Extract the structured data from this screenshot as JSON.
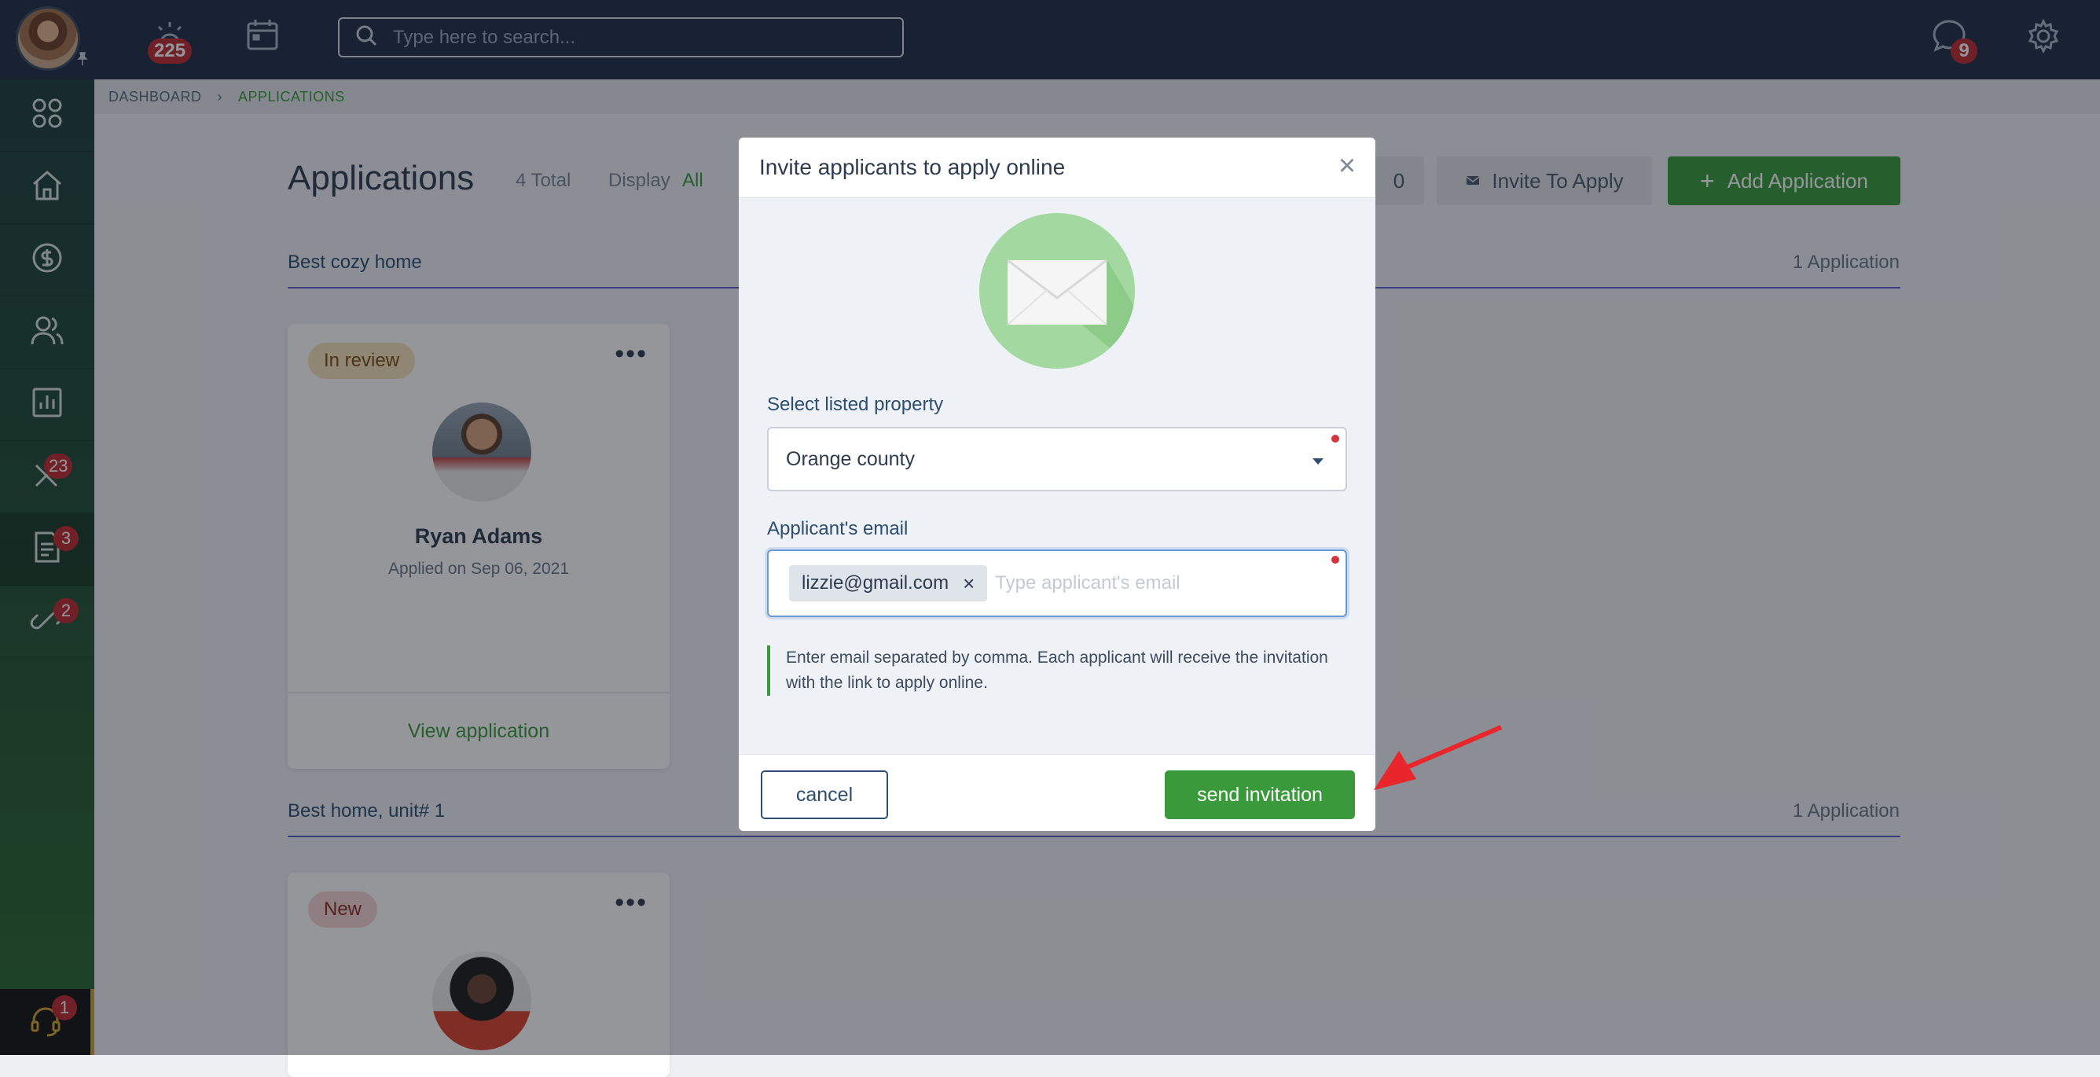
{
  "topbar": {
    "alerts_badge": "225",
    "search_placeholder": "Type here to search...",
    "messages_badge": "9"
  },
  "sidebar": {
    "badges": {
      "maintenance": "23",
      "applications": "3",
      "links": "2",
      "support": "1"
    }
  },
  "breadcrumb": {
    "home": "DASHBOARD",
    "current": "APPLICATIONS"
  },
  "page": {
    "title": "Applications",
    "total": "4 Total",
    "display_label": "Display",
    "display_value": "All",
    "count": "0",
    "invite_button": "Invite To Apply",
    "add_button": "Add Application"
  },
  "sections": [
    {
      "title": "Best cozy home",
      "count": "1 Application",
      "card": {
        "status": "In review",
        "name": "Ryan Adams",
        "applied": "Applied on Sep 06, 2021",
        "link": "View application"
      }
    },
    {
      "title": "Best home, unit# 1",
      "count": "1 Application",
      "card": {
        "status": "New"
      }
    }
  ],
  "modal": {
    "title": "Invite applicants to apply online",
    "property_label": "Select listed property",
    "property_value": "Orange county",
    "email_label": "Applicant's email",
    "email_chip": "lizzie@gmail.com",
    "email_placeholder": "Type applicant's email",
    "hint": "Enter email separated by comma. Each applicant will receive the invitation with the link to apply online.",
    "cancel": "cancel",
    "send": "send invitation"
  },
  "colors": {
    "brand_green": "#3a9a3b",
    "topbar": "#1f2d42",
    "badge_red": "#c0292f",
    "arrow": "#e8262b"
  }
}
